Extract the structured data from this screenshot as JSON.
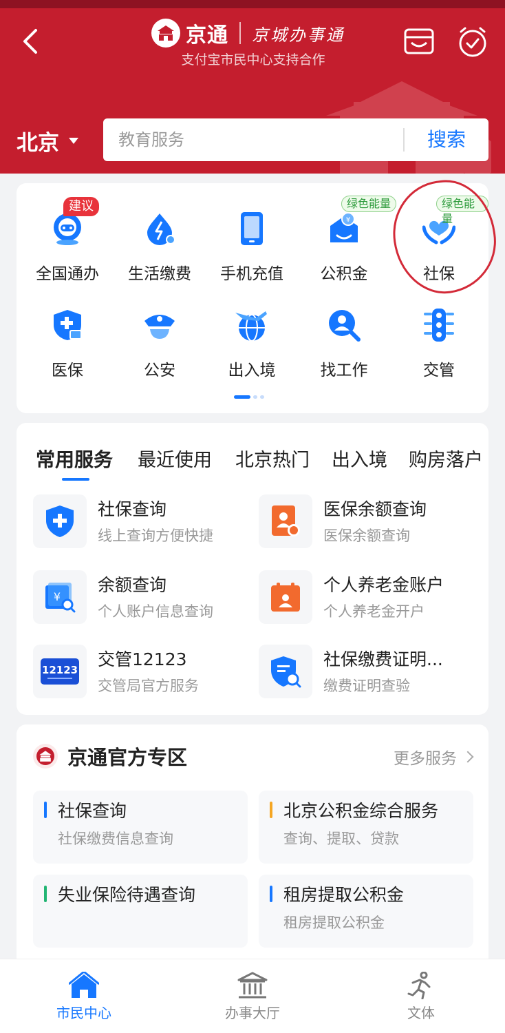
{
  "header": {
    "brand_name": "京通",
    "slogan": "京城办事通",
    "subtitle": "支付宝市民中心支持合作",
    "city": "北京",
    "search_placeholder": "教育服务",
    "search_button": "搜索"
  },
  "grid": {
    "items": [
      {
        "label": "全国通办",
        "icon": "nationwide-icon",
        "badge": "建议"
      },
      {
        "label": "生活缴费",
        "icon": "utility-payment-icon",
        "badge": ""
      },
      {
        "label": "手机充值",
        "icon": "phone-recharge-icon",
        "badge": ""
      },
      {
        "label": "公积金",
        "icon": "housing-fund-icon",
        "badge": "绿色能量"
      },
      {
        "label": "社保",
        "icon": "social-security-icon",
        "badge": "绿色能量"
      },
      {
        "label": "医保",
        "icon": "medical-insurance-icon",
        "badge": ""
      },
      {
        "label": "公安",
        "icon": "police-icon",
        "badge": ""
      },
      {
        "label": "出入境",
        "icon": "immigration-icon",
        "badge": ""
      },
      {
        "label": "找工作",
        "icon": "job-search-icon",
        "badge": ""
      },
      {
        "label": "交管",
        "icon": "traffic-icon",
        "badge": ""
      }
    ],
    "page_index": 1,
    "page_count": 3
  },
  "services": {
    "tabs": [
      "常用服务",
      "最近使用",
      "北京热门",
      "出入境",
      "购房落户"
    ],
    "active_tab": 0,
    "items": [
      {
        "title": "社保查询",
        "subtitle": "线上查询方便快捷",
        "icon": "shield-plus-icon"
      },
      {
        "title": "医保余额查询",
        "subtitle": "医保余额查询",
        "icon": "medical-card-icon"
      },
      {
        "title": "余额查询",
        "subtitle": "个人账户信息查询",
        "icon": "balance-search-icon"
      },
      {
        "title": "个人养老金账户",
        "subtitle": "个人养老金开户",
        "icon": "calendar-person-icon"
      },
      {
        "title": "交管12123",
        "subtitle": "交管局官方服务",
        "icon": "traffic-12123-icon"
      },
      {
        "title": "社保缴费证明...",
        "subtitle": "缴费证明查验",
        "icon": "certificate-search-icon"
      }
    ]
  },
  "official": {
    "title": "京通官方专区",
    "more": "更多服务",
    "tiles": [
      {
        "title": "社保查询",
        "subtitle": "社保缴费信息查询",
        "accent": "#1677ff"
      },
      {
        "title": "北京公积金综合服务",
        "subtitle": "查询、提取、贷款",
        "accent": "#f5a623"
      },
      {
        "title": "失业保险待遇查询",
        "subtitle": "",
        "accent": "#22b573"
      },
      {
        "title": "租房提取公积金",
        "subtitle": "租房提取公积金",
        "accent": "#1677ff"
      }
    ]
  },
  "bottom_nav": {
    "items": [
      {
        "label": "市民中心",
        "icon": "home-icon",
        "active": true
      },
      {
        "label": "办事大厅",
        "icon": "government-hall-icon",
        "active": false
      },
      {
        "label": "文体",
        "icon": "running-person-icon",
        "active": false
      }
    ]
  },
  "colors": {
    "header_red": "#c41e2e",
    "accent_blue": "#1677ff",
    "badge_red": "#e8333b",
    "badge_green": "#2b9a3a"
  }
}
